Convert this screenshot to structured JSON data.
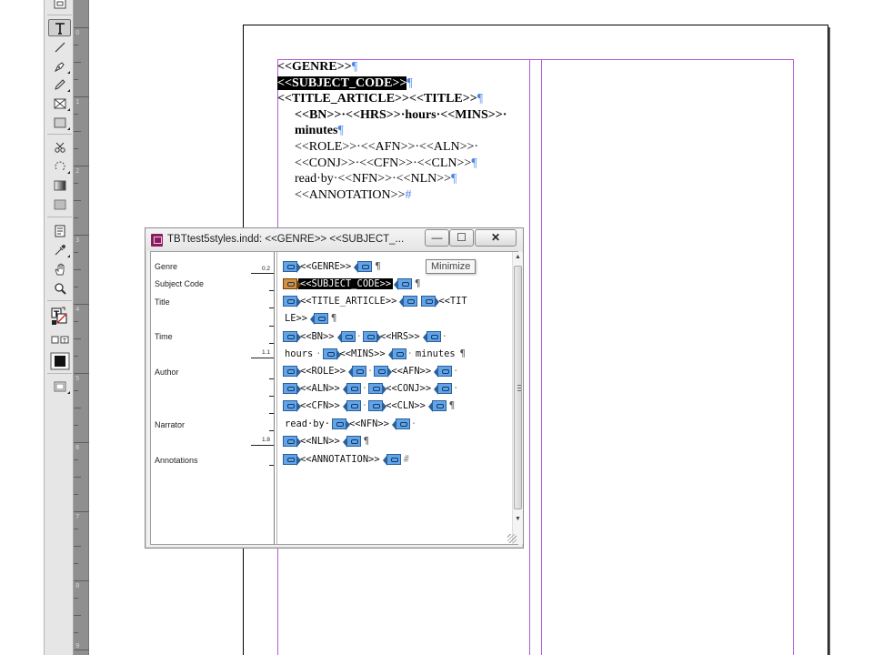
{
  "document": {
    "lines": [
      {
        "t1": "<<GENRE>>",
        "mark": "¶"
      },
      {
        "t1": "<<SUBJECT_CODE>>",
        "mark": "¶"
      },
      {
        "t1": "<<TITLE_ARTICLE>><<TITLE>>",
        "mark": "¶"
      },
      {
        "t1": "<<BN>>·<<HRS>>·hours·<<MINS>>·"
      },
      {
        "t1": "minutes",
        "mark": "¶"
      },
      {
        "t1": "<<ROLE>>·<<AFN>>·<<ALN>>·"
      },
      {
        "t1": "<<CONJ>>·<<CFN>>·<<CLN>>",
        "mark": "¶"
      },
      {
        "t1": "read·by·<<NFN>>·<<NLN>>",
        "mark": "¶"
      },
      {
        "t1": "<<ANNOTATION>>",
        "mark": "#"
      }
    ]
  },
  "story_editor": {
    "title": "TBTtest5styles.indd: <<GENRE>> <<SUBJECT_...",
    "minimize_label": "—",
    "maximize_label": "☐",
    "close_label": "✕",
    "tooltip": "Minimize",
    "styles": [
      {
        "name": "Genre",
        "depth": "0.2"
      },
      {
        "name": "Subject Code"
      },
      {
        "name": "Title"
      },
      {
        "name": "Time",
        "depth": "1.1"
      },
      {
        "name": "Author"
      },
      {
        "name": "Narrator",
        "depth": "1.8"
      },
      {
        "name": "Annotations"
      }
    ],
    "story": {
      "genre": "<<GENRE>>",
      "subject_code": "<<SUBJECT_CODE>>",
      "title_article": "<<TITLE_ARTICLE>>",
      "title_a": "<<TIT",
      "title_b": "LE>>",
      "bn": "<<BN>>",
      "hrs": "<<HRS>>",
      "hours": "hours",
      "mins": "<<MINS>>",
      "minutes": "minutes",
      "role": "<<ROLE>>",
      "afn": "<<AFN>>",
      "aln": "<<ALN>>",
      "conj": "<<CONJ>>",
      "cfn": "<<CFN>>",
      "cln": "<<CLN>>",
      "read_by": "read·by·",
      "nfn": "<<NFN>>",
      "nln": "<<NLN>>",
      "annotation": "<<ANNOTATION>>",
      "pilcrow": "¶",
      "dot": "·",
      "hash": "#"
    }
  },
  "ruler": {
    "numbers": [
      "0",
      "1",
      "2",
      "3",
      "4",
      "5",
      "6",
      "7",
      "8",
      "9"
    ]
  },
  "colors": {
    "selection_tag": "#d6903c",
    "tag": "#63a4e8",
    "guide": "#b25cd6"
  }
}
